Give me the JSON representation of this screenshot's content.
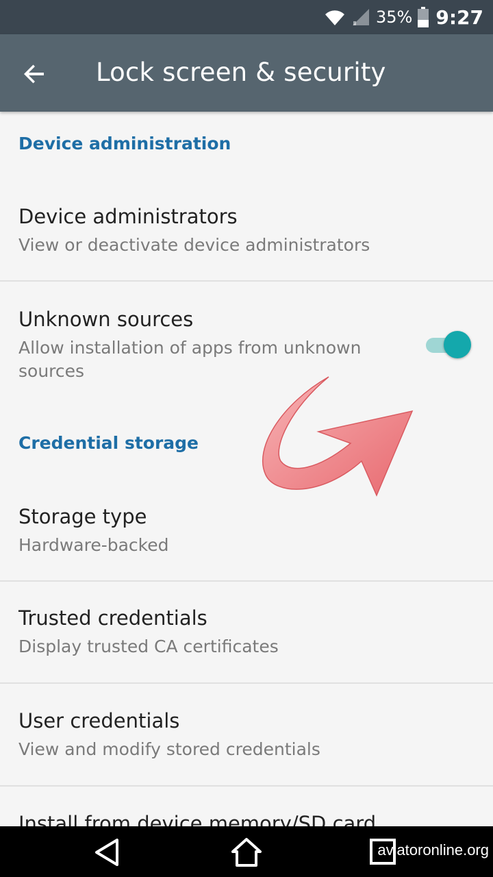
{
  "status_bar": {
    "battery_percent": "35%",
    "time": "9:27",
    "icons": [
      "wifi-icon",
      "signal-icon",
      "battery-icon"
    ]
  },
  "app_bar": {
    "title": "Lock screen & security",
    "back_icon": "arrow-back-icon"
  },
  "sections": {
    "device_administration": {
      "header": "Device administration",
      "device_administrators": {
        "title": "Device administrators",
        "summary": "View or deactivate device administrators"
      },
      "unknown_sources": {
        "title": "Unknown sources",
        "summary": "Allow installation of apps from unknown sources",
        "enabled": true
      }
    },
    "credential_storage": {
      "header": "Credential storage",
      "storage_type": {
        "title": "Storage type",
        "summary": "Hardware-backed"
      },
      "trusted_credentials": {
        "title": "Trusted credentials",
        "summary": "Display trusted CA certificates"
      },
      "user_credentials": {
        "title": "User credentials",
        "summary": "View and modify stored credentials"
      },
      "install_from_storage": {
        "title": "Install from device memory/SD card"
      }
    }
  },
  "nav_bar": {
    "icons": [
      "back-triangle-icon",
      "home-icon",
      "recents-icon"
    ],
    "watermark": "aviatoronline.org"
  },
  "colors": {
    "status_bar": "#3b4650",
    "app_bar": "#56656f",
    "section_header": "#1e6ea6",
    "toggle_accent": "#14a8ac",
    "overlay_arrow": "#ef7f82"
  }
}
